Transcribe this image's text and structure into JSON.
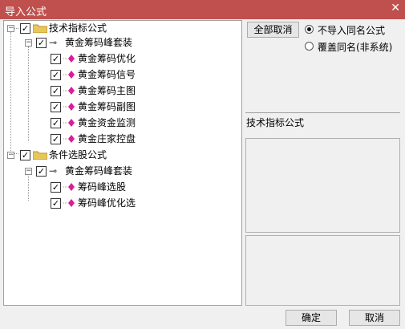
{
  "window": {
    "title": "导入公式",
    "close_glyph": "✕"
  },
  "tree": {
    "groups": [
      {
        "label": "技术指标公式",
        "checked": true,
        "expander": "−",
        "subgroup": {
          "label": "黄金筹码峰套装",
          "checked": true,
          "expander": "−",
          "items": [
            "黄金筹码优化",
            "黄金筹码信号",
            "黄金筹码主图",
            "黄金筹码副图",
            "黄金资金监测",
            "黄金庄家控盘"
          ]
        }
      },
      {
        "label": "条件选股公式",
        "checked": true,
        "expander": "−",
        "subgroup": {
          "label": "黄金筹码峰套装",
          "checked": true,
          "expander": "−",
          "items": [
            "筹码峰选股",
            "筹码峰优化选"
          ]
        }
      }
    ]
  },
  "right": {
    "deselect_all_label": "全部取消",
    "radio_options": [
      {
        "label": "不导入同名公式",
        "selected": true
      },
      {
        "label": "覆盖同名(非系统)",
        "selected": false
      }
    ],
    "description_title": "技术指标公式"
  },
  "footer": {
    "ok_label": "确定",
    "cancel_label": "取消"
  },
  "colors": {
    "title_bar": "#c0504d",
    "folder": "#e8c75a",
    "leaf_icon": "#d81f9a"
  }
}
